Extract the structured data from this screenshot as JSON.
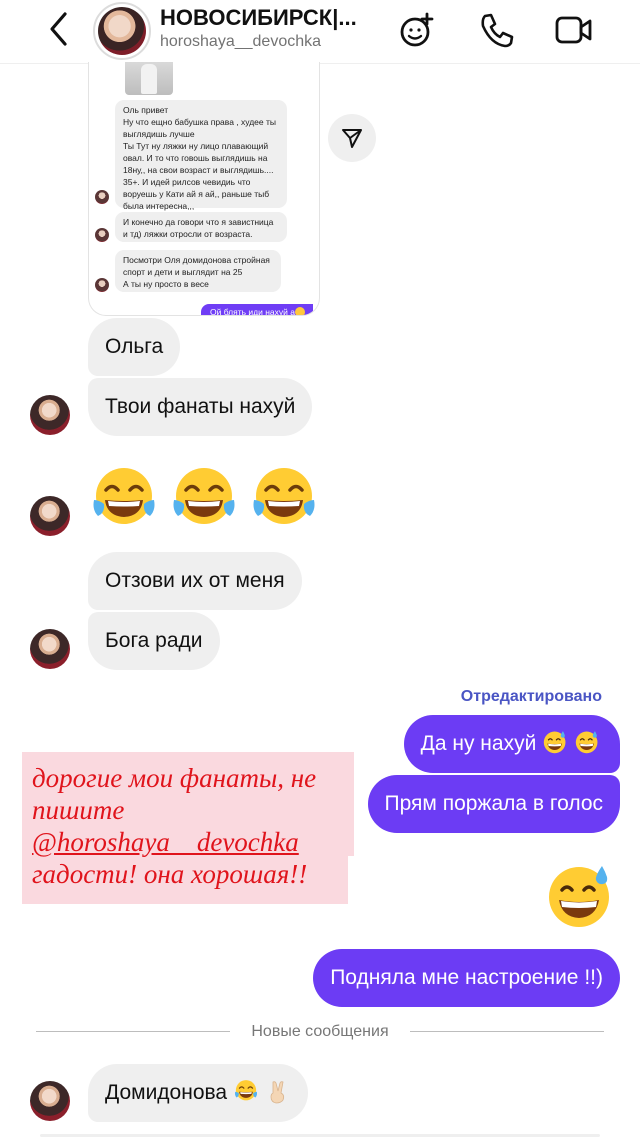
{
  "header": {
    "title": "НОВОСИБИРСК|...",
    "username": "horoshaya__devochka"
  },
  "shared_screenshot": {
    "messages": [
      "Оль привет\nНу что ещно бабушка права , худее ты\nвыглядишь лучше\nТы Тут ну ляжки ну лицо плавающий\nовал. И то что говошь выглядишь на\n18ну,, на свои возраст и выглядишь....\n35+. И идей рилсов чевидиь что\nворуешь у Кати ай я ай,, раньше тыб\nбыла интересна,,,",
      "И конечно да говори что я завистница\nи тд) ляжки отросли от возраста.",
      "Посмотри Оля домидонова стройная\nспорт и дети и выглядит на 25\nА ты ну просто в весе"
    ],
    "reply": "Ой блять иди нахуй а"
  },
  "messages": {
    "m1": "Ольга",
    "m2": "Твои фанаты нахуй",
    "m3": "Отзови их от меня",
    "m4": "Бога ради",
    "m5": "Да ну нахуй",
    "m6": "Прям поржала в голос",
    "m7": "Подняла мне настроение !!)",
    "m8": "Домидонова"
  },
  "edited_label": "Отредактировано",
  "overlay": {
    "line1": "дорогие мои фанаты, не",
    "line2": "пишите",
    "line3": "@horoshaya__devochka",
    "line4": "гадости! она хорошая!!"
  },
  "divider_label": "Новые сообщения",
  "icons": [
    "chevron-left-icon",
    "avatar",
    "emoji-sticker-icon",
    "phone-icon",
    "video-call-icon",
    "share-icon",
    "face-with-tears-of-joy-emoji",
    "grinning-sweat-emoji",
    "victory-hand-emoji"
  ],
  "colors": {
    "outgoing_bubble": "#6c3cf4",
    "incoming_bubble": "#efefef",
    "edited_label": "#4a55c4",
    "overlay_text": "#e0141c",
    "overlay_background": "#fad6dc"
  }
}
